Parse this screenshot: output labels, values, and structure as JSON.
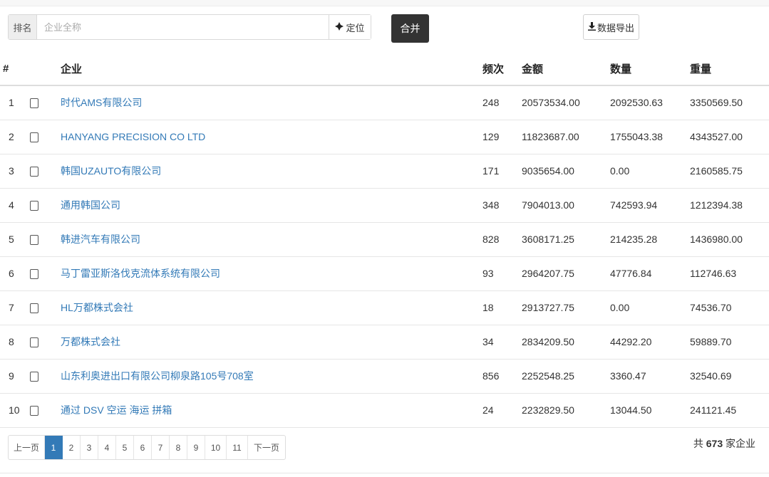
{
  "toolbar": {
    "rank_label": "排名",
    "search_placeholder": "企业全称",
    "search_value": "",
    "locate_label": "定位",
    "merge_label": "合并",
    "export_label": "数据导出"
  },
  "table": {
    "headers": {
      "num": "#",
      "enterprise": "企业",
      "frequency": "频次",
      "amount": "金额",
      "quantity": "数量",
      "weight": "重量"
    },
    "rows": [
      {
        "num": "1",
        "enterprise": "时代AMS有限公司",
        "frequency": "248",
        "amount": "20573534.00",
        "quantity": "2092530.63",
        "weight": "3350569.50"
      },
      {
        "num": "2",
        "enterprise": "HANYANG PRECISION CO LTD",
        "frequency": "129",
        "amount": "11823687.00",
        "quantity": "1755043.38",
        "weight": "4343527.00"
      },
      {
        "num": "3",
        "enterprise": "韩国UZAUTO有限公司",
        "frequency": "171",
        "amount": "9035654.00",
        "quantity": "0.00",
        "weight": "2160585.75"
      },
      {
        "num": "4",
        "enterprise": "通用韩国公司",
        "frequency": "348",
        "amount": "7904013.00",
        "quantity": "742593.94",
        "weight": "1212394.38"
      },
      {
        "num": "5",
        "enterprise": "韩进汽车有限公司",
        "frequency": "828",
        "amount": "3608171.25",
        "quantity": "214235.28",
        "weight": "1436980.00"
      },
      {
        "num": "6",
        "enterprise": "马丁雷亚斯洛伐克流体系统有限公司",
        "frequency": "93",
        "amount": "2964207.75",
        "quantity": "47776.84",
        "weight": "112746.63"
      },
      {
        "num": "7",
        "enterprise": "HL万都株式会社",
        "frequency": "18",
        "amount": "2913727.75",
        "quantity": "0.00",
        "weight": "74536.70"
      },
      {
        "num": "8",
        "enterprise": "万都株式会社",
        "frequency": "34",
        "amount": "2834209.50",
        "quantity": "44292.20",
        "weight": "59889.70"
      },
      {
        "num": "9",
        "enterprise": "山东利奥进出口有限公司柳泉路105号708室",
        "frequency": "856",
        "amount": "2252548.25",
        "quantity": "3360.47",
        "weight": "32540.69"
      },
      {
        "num": "10",
        "enterprise": "通过 DSV 空运 海运 拼箱",
        "frequency": "24",
        "amount": "2232829.50",
        "quantity": "13044.50",
        "weight": "241121.45"
      }
    ]
  },
  "pagination": {
    "prev_label": "上一页",
    "pages": [
      "1",
      "2",
      "3",
      "4",
      "5",
      "6",
      "7",
      "8",
      "9",
      "10",
      "11"
    ],
    "active_page": "1",
    "next_label": "下一页"
  },
  "summary": {
    "prefix": "共",
    "count": "673",
    "suffix": "家企业"
  },
  "icons": {
    "locate": "crosshair-icon",
    "export": "download-icon"
  },
  "colors": {
    "link": "#337ab7",
    "merge_button": "#333333",
    "active_page": "#337ab7"
  }
}
